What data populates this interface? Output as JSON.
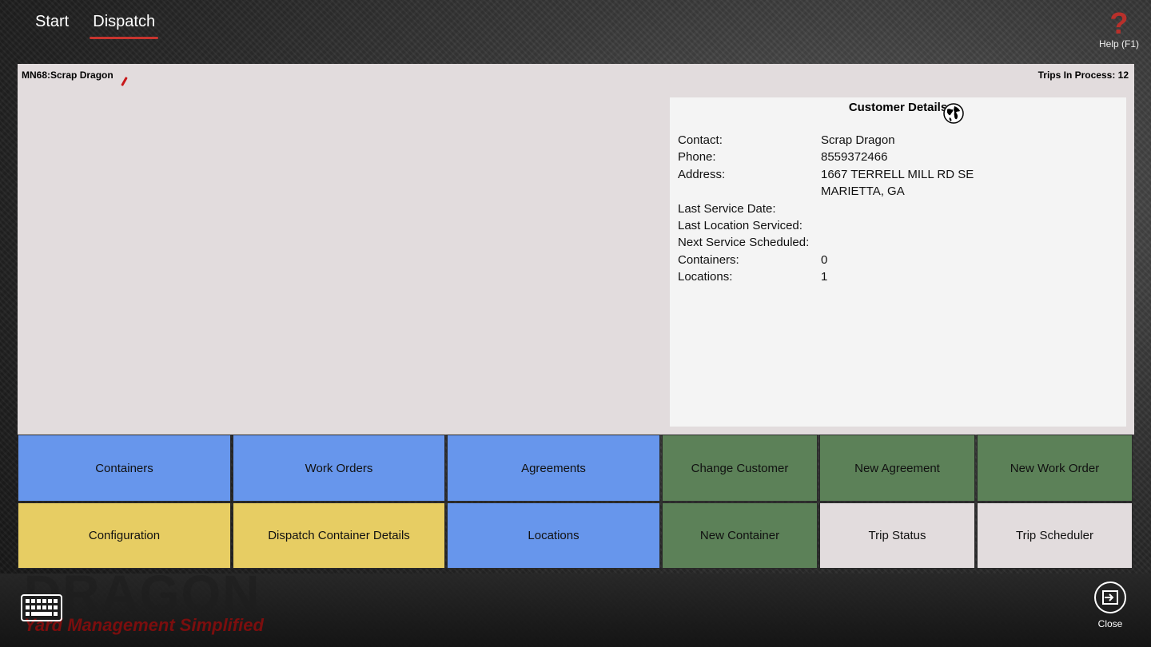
{
  "nav": {
    "tabs": [
      {
        "label": "Start"
      },
      {
        "label": "Dispatch"
      }
    ]
  },
  "help": {
    "label": "Help (F1)"
  },
  "panel": {
    "customer_name": "MN68:Scrap Dragon",
    "trips_in_process": "Trips In Process: 12"
  },
  "details": {
    "title": "Customer Details",
    "rows": [
      {
        "label": "Contact:",
        "value": "Scrap Dragon"
      },
      {
        "label": "Phone:",
        "value": "8559372466"
      },
      {
        "label": "Address:",
        "value": "1667 TERRELL MILL RD SE"
      },
      {
        "label": "",
        "value": "MARIETTA, GA"
      },
      {
        "label": "Last Service Date:",
        "value": ""
      },
      {
        "label": "Last Location Serviced:",
        "value": ""
      },
      {
        "label": "Next Service Scheduled:",
        "value": ""
      },
      {
        "label": "Containers:",
        "value": "0"
      },
      {
        "label": "Locations:",
        "value": "1"
      }
    ]
  },
  "tiles": [
    {
      "label": "Containers"
    },
    {
      "label": "Work Orders"
    },
    {
      "label": "Agreements"
    },
    {
      "label": "Change Customer"
    },
    {
      "label": "New Agreement"
    },
    {
      "label": "New Work Order"
    },
    {
      "label": "Configuration"
    },
    {
      "label": "Dispatch Container Details"
    },
    {
      "label": "Locations"
    },
    {
      "label": "New Container"
    },
    {
      "label": "Trip Status"
    },
    {
      "label": "Trip Scheduler"
    }
  ],
  "branding": {
    "word": "DRAGON",
    "tagline": "Yard Management Simplified"
  },
  "bottom": {
    "close_label": "Close"
  },
  "colors": {
    "blue_tile": "#6796ec",
    "yellow_tile": "#e7cd63",
    "green_tile": "#5c8158",
    "grey_tile": "#e2dcdd",
    "accent_red": "#c8352f"
  }
}
